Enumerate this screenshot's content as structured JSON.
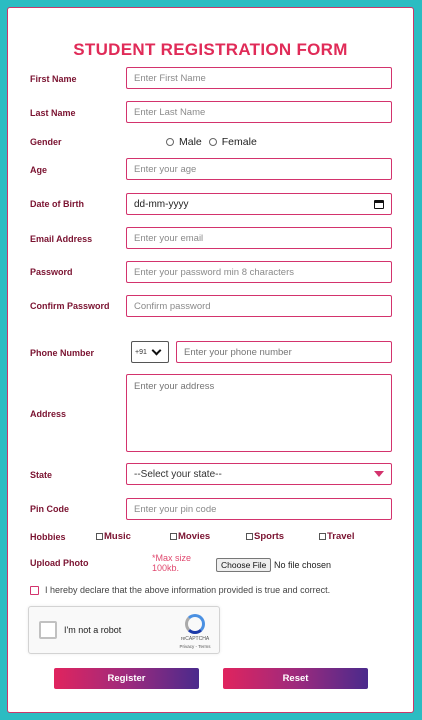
{
  "form": {
    "title": "STUDENT REGISTRATION FORM",
    "first_name": {
      "label": "First Name",
      "placeholder": "Enter First Name"
    },
    "last_name": {
      "label": "Last Name",
      "placeholder": "Enter Last Name"
    },
    "gender": {
      "label": "Gender",
      "options": [
        "Male",
        "Female"
      ]
    },
    "age": {
      "label": "Age",
      "placeholder": "Enter your age"
    },
    "dob": {
      "label": "Date of Birth",
      "value": "dd-mm-yyyy"
    },
    "email": {
      "label": "Email Address",
      "placeholder": "Enter your email"
    },
    "password": {
      "label": "Password",
      "placeholder": "Enter your password min 8 characters"
    },
    "confirm_password": {
      "label": "Confirm Password",
      "placeholder": "Confirm password"
    },
    "phone": {
      "label": "Phone Number",
      "country_code": "+91",
      "placeholder": "Enter your phone number"
    },
    "address": {
      "label": "Address",
      "placeholder": "Enter your address"
    },
    "state": {
      "label": "State",
      "value": "--Select your state--"
    },
    "pin_code": {
      "label": "Pin Code",
      "placeholder": "Enter your pin code"
    },
    "hobbies": {
      "label": "Hobbies",
      "options": [
        "Music",
        "Movies",
        "Sports",
        "Travel"
      ]
    },
    "upload": {
      "label": "Upload Photo",
      "max_size": "*Max size 100kb.",
      "button": "Choose File",
      "status": "No file chosen"
    },
    "declaration": "I hereby declare that the above information provided is true and correct.",
    "captcha": {
      "label": "I'm not a robot",
      "brand": "reCAPTCHA",
      "links": "Privacy - Terms"
    },
    "register_label": "Register",
    "reset_label": "Reset"
  },
  "colors": {
    "background": "#2bbcc2",
    "accent": "#e02b58",
    "label": "#7a1230",
    "border": "#d3336d"
  }
}
